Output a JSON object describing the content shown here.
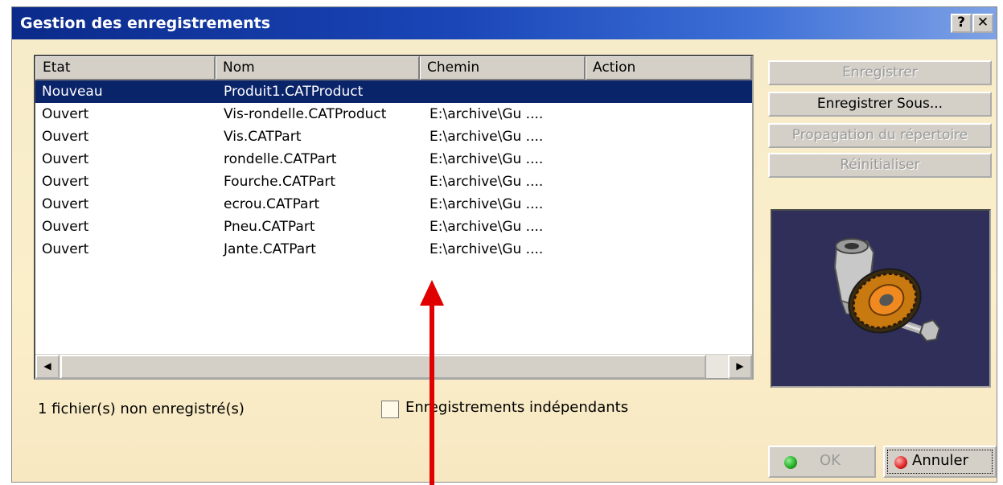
{
  "window": {
    "title": "Gestion des enregistrements",
    "help_label": "?",
    "close_label": "✕"
  },
  "table": {
    "columns": [
      "Etat",
      "Nom",
      "Chemin",
      "Action"
    ],
    "rows": [
      {
        "etat": "Nouveau",
        "nom": "Produit1.CATProduct",
        "chemin": "",
        "action": ""
      },
      {
        "etat": "Ouvert",
        "nom": "Vis-rondelle.CATProduct",
        "chemin": "E:\\archive\\Gu ....",
        "action": ""
      },
      {
        "etat": "Ouvert",
        "nom": "Vis.CATPart",
        "chemin": "E:\\archive\\Gu ....",
        "action": ""
      },
      {
        "etat": "Ouvert",
        "nom": "rondelle.CATPart",
        "chemin": "E:\\archive\\Gu ....",
        "action": ""
      },
      {
        "etat": "Ouvert",
        "nom": "Fourche.CATPart",
        "chemin": "E:\\archive\\Gu ....",
        "action": ""
      },
      {
        "etat": "Ouvert",
        "nom": "ecrou.CATPart",
        "chemin": "E:\\archive\\Gu ....",
        "action": ""
      },
      {
        "etat": "Ouvert",
        "nom": "Pneu.CATPart",
        "chemin": "E:\\archive\\Gu ....",
        "action": ""
      },
      {
        "etat": "Ouvert",
        "nom": "Jante.CATPart",
        "chemin": "E:\\archive\\Gu ....",
        "action": ""
      }
    ],
    "selected_index": 0
  },
  "scrollbar": {
    "left_arrow": "◀",
    "right_arrow": "▶"
  },
  "actions": {
    "enregistrer": "Enregistrer",
    "enregistrer_sous": "Enregistrer Sous...",
    "propagation": "Propagation du répertoire",
    "reinitialiser": "Réinitialiser"
  },
  "preview": {
    "icon": "mechanical-assembly-thumbnail"
  },
  "status": {
    "text": "1 fichier(s) non enregistré(s)"
  },
  "options": {
    "independent_label": "Enregistrements indépendants",
    "independent_checked": false
  },
  "buttons": {
    "ok": "OK",
    "cancel": "Annuler"
  },
  "colors": {
    "title_bar": "#0b2a8a",
    "selection": "#0a246a",
    "annotation_arrow": "#e00000",
    "ok_dot": "#22aa22",
    "cancel_dot": "#dd2222"
  }
}
